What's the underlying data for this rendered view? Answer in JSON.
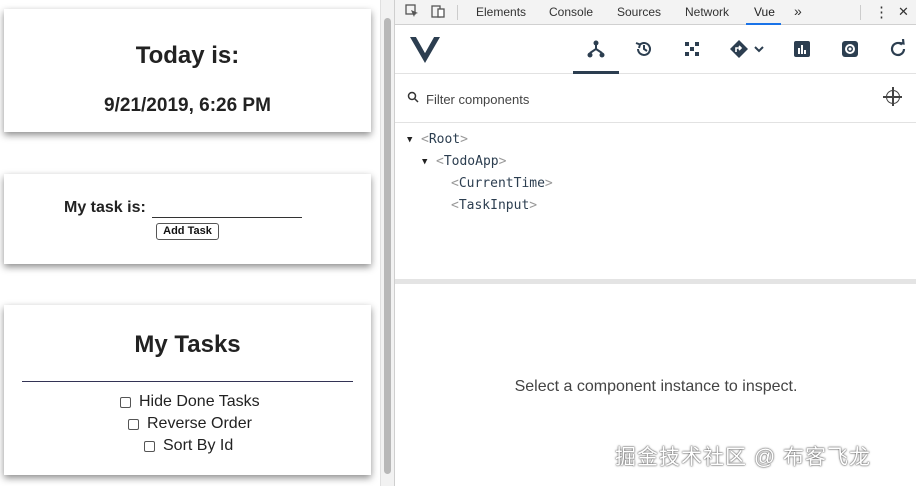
{
  "app": {
    "current_time": {
      "title": "Today is:",
      "datetime": "9/21/2019, 6:26 PM"
    },
    "task_input": {
      "label": "My task is:",
      "value": "",
      "button": "Add Task"
    },
    "my_tasks": {
      "title": "My Tasks",
      "options": [
        {
          "label": "Hide Done Tasks",
          "checked": false
        },
        {
          "label": "Reverse Order",
          "checked": false
        },
        {
          "label": "Sort By Id",
          "checked": false
        }
      ]
    }
  },
  "devtools": {
    "tabs": [
      "Elements",
      "Console",
      "Sources",
      "Network",
      "Vue"
    ],
    "active_tab": "Vue",
    "more_tabs_glyph": "»",
    "menu_glyph": "⋮",
    "close_glyph": "✕",
    "accent_color": "#1a73e8"
  },
  "vue": {
    "logo_color": "#2c3e50",
    "toolbar_icons": [
      "components-icon",
      "history-icon",
      "vuex-icon",
      "routing-icon",
      "performance-icon",
      "settings-icon",
      "refresh-icon"
    ],
    "filter_placeholder": "Filter components",
    "tree": [
      {
        "name": "Root",
        "expanded": true
      },
      {
        "name": "TodoApp",
        "expanded": true
      },
      {
        "name": "CurrentTime"
      },
      {
        "name": "TaskInput"
      }
    ],
    "inspect_message": "Select a component instance to inspect."
  },
  "watermark": "掘金技术社区 @ 布客飞龙"
}
